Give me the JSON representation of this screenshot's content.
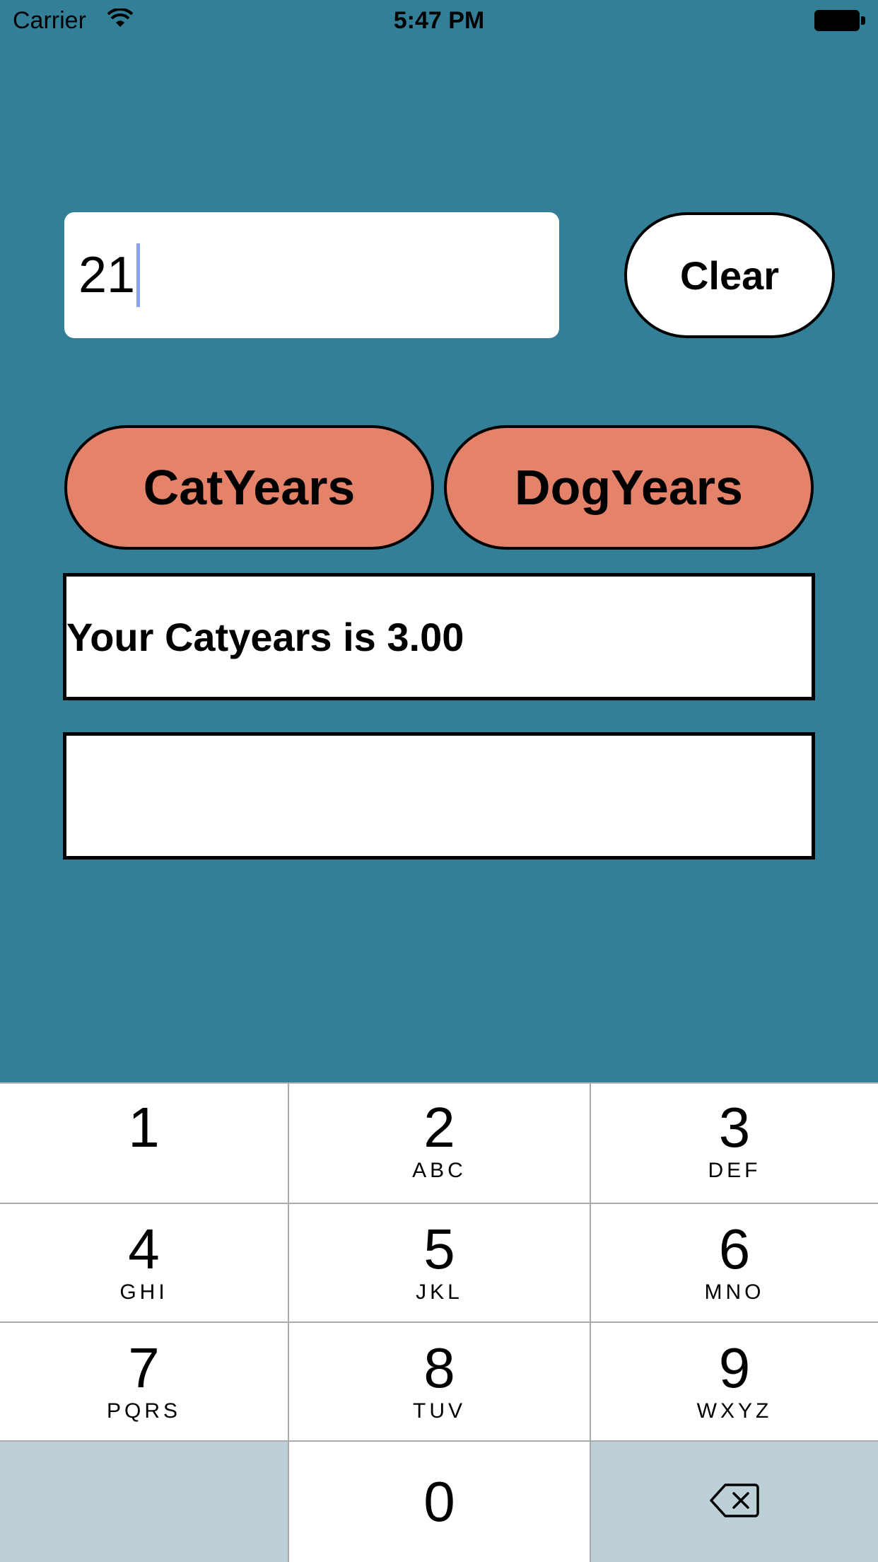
{
  "status_bar": {
    "carrier": "Carrier",
    "time": "5:47 PM",
    "wifi_icon": "wifi-icon",
    "battery_icon": "battery-full-icon"
  },
  "input": {
    "value": "21"
  },
  "buttons": {
    "clear": "Clear",
    "cat_years": "CatYears",
    "dog_years": "DogYears"
  },
  "results": {
    "cat": "Your Catyears is 3.00",
    "dog": ""
  },
  "keypad": {
    "keys": [
      {
        "num": "1",
        "letters": ""
      },
      {
        "num": "2",
        "letters": "ABC"
      },
      {
        "num": "3",
        "letters": "DEF"
      },
      {
        "num": "4",
        "letters": "GHI"
      },
      {
        "num": "5",
        "letters": "JKL"
      },
      {
        "num": "6",
        "letters": "MNO"
      },
      {
        "num": "7",
        "letters": "PQRS"
      },
      {
        "num": "8",
        "letters": "TUV"
      },
      {
        "num": "9",
        "letters": "WXYZ"
      },
      {
        "num": "0",
        "letters": ""
      }
    ],
    "delete_icon": "backspace-icon"
  },
  "colors": {
    "background": "#347f98",
    "button_accent": "#e5826a",
    "keypad_gray": "#bdd0d8",
    "cursor": "#8aa3ee"
  }
}
